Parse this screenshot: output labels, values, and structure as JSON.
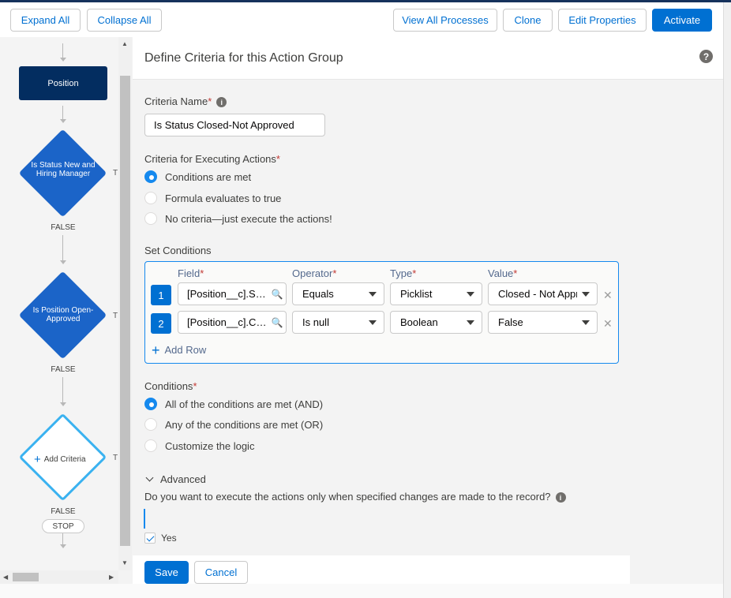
{
  "toolbar": {
    "expand_all": "Expand All",
    "collapse_all": "Collapse All",
    "view_all_processes": "View All Processes",
    "clone": "Clone",
    "edit_properties": "Edit Properties",
    "activate": "Activate"
  },
  "canvas": {
    "start_node": "Position",
    "criteria1": "Is Status New and Hiring Manager",
    "criteria2": "Is Position Open-Approved",
    "add_criteria": "Add Criteria",
    "false_label": "FALSE",
    "true_trunc": "TI",
    "stop": "STOP"
  },
  "panel": {
    "title": "Define Criteria for this Action Group",
    "criteria_name_label": "Criteria Name",
    "criteria_name_value": "Is Status Closed-Not Approved",
    "executing_label": "Criteria for Executing Actions",
    "exec_options": [
      "Conditions are met",
      "Formula evaluates to true",
      "No criteria—just execute the actions!"
    ],
    "set_conditions_label": "Set Conditions",
    "columns": {
      "field": "Field",
      "operator": "Operator",
      "type": "Type",
      "value": "Value"
    },
    "rows": [
      {
        "num": "1",
        "field": "[Position__c].Sta...",
        "operator": "Equals",
        "type": "Picklist",
        "value": "Closed - Not Approv"
      },
      {
        "num": "2",
        "field": "[Position__c].Clo...",
        "operator": "Is null",
        "type": "Boolean",
        "value": "False"
      }
    ],
    "add_row": "Add Row",
    "conditions_label": "Conditions",
    "cond_options": [
      "All of the conditions are met (AND)",
      "Any of the conditions are met (OR)",
      "Customize the logic"
    ],
    "advanced_label": "Advanced",
    "advanced_question": "Do you want to execute the actions only when specified changes are made to the record?",
    "yes_label": "Yes",
    "save": "Save",
    "cancel": "Cancel"
  },
  "colors": {
    "brand": "#0070d2",
    "node_dark": "#032d60",
    "diamond": "#1b64c8",
    "add_border": "#3ab2f0",
    "required": "#c23934"
  }
}
